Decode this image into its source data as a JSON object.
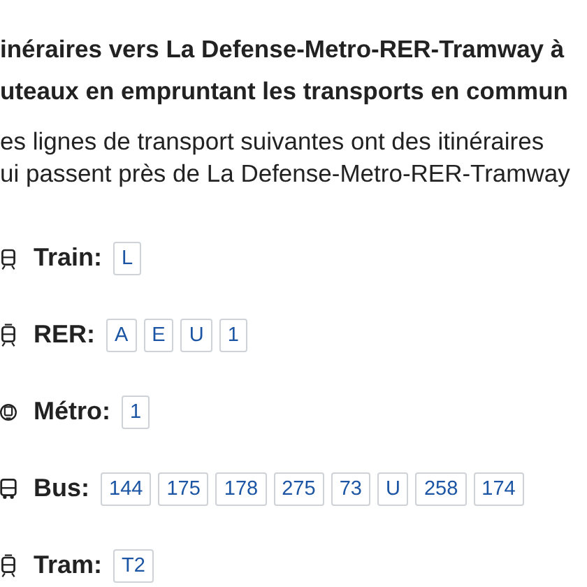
{
  "heading_lines": [
    "inéraires vers La Defense-Metro-RER-Tramway à",
    "uteaux en empruntant les transports en commun"
  ],
  "intro_lines": [
    "es lignes de transport suivantes ont des itinéraires",
    "ui passent près de La Defense-Metro-RER-Tramway"
  ],
  "modes": [
    {
      "kind": "train",
      "label": "Train:",
      "lines": [
        "L"
      ]
    },
    {
      "kind": "rer",
      "label": "RER:",
      "lines": [
        "A",
        "E",
        "U",
        "1"
      ]
    },
    {
      "kind": "metro",
      "label": "Métro:",
      "lines": [
        "1"
      ]
    },
    {
      "kind": "bus",
      "label": "Bus:",
      "lines": [
        "144",
        "175",
        "178",
        "275",
        "73",
        "U",
        "258",
        "174"
      ]
    },
    {
      "kind": "tram",
      "label": "Tram:",
      "lines": [
        "T2"
      ]
    }
  ]
}
